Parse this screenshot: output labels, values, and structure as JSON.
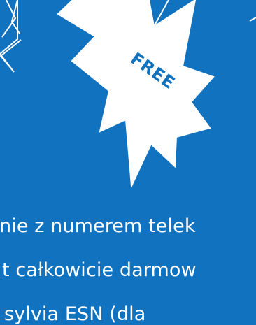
{
  "badge": {
    "label": "FREE"
  },
  "message": {
    "lines": [
      "nie z numerem telek",
      "t całkowicie darmow",
      "sylvia ESN (dla"
    ]
  },
  "colors": {
    "background": "#1172bf",
    "foreground": "#ffffff"
  },
  "icons": {
    "left": "star-outline-icon",
    "center": "star-burst-icon",
    "right": "star-outline-icon"
  }
}
